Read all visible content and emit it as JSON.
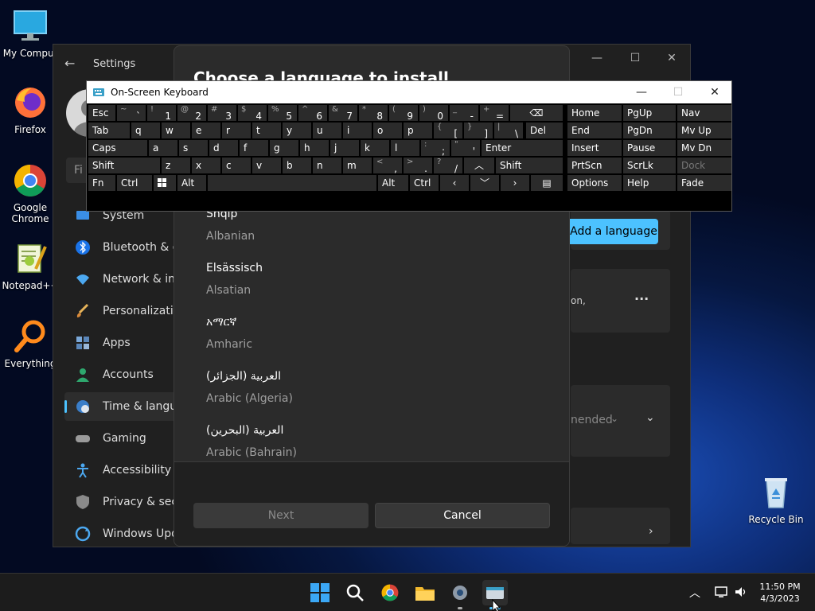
{
  "desktop": {
    "icons": [
      {
        "label": "My Comput"
      },
      {
        "label": "Firefox"
      },
      {
        "label": "Google Chrome"
      },
      {
        "label": "Notepad++"
      },
      {
        "label": "Everything"
      },
      {
        "label": "Recycle Bin"
      }
    ]
  },
  "settings": {
    "title": "Settings",
    "search_placeholder": "Fi",
    "nav": [
      {
        "label": "System"
      },
      {
        "label": "Bluetooth & de"
      },
      {
        "label": "Network & inte"
      },
      {
        "label": "Personalization"
      },
      {
        "label": "Apps"
      },
      {
        "label": "Accounts"
      },
      {
        "label": "Time & langua"
      },
      {
        "label": "Gaming"
      },
      {
        "label": "Accessibility"
      },
      {
        "label": "Privacy & secu"
      },
      {
        "label": "Windows Upda"
      }
    ],
    "add_language_label": "Add a language",
    "card_text": "on,",
    "more_label": "···",
    "recommended_text": "nended"
  },
  "dialog": {
    "title": "Choose a language to install",
    "languages": [
      {
        "native": "Shqip",
        "english": "Albanian"
      },
      {
        "native": "Elsässisch",
        "english": "Alsatian"
      },
      {
        "native": "አማርኛ",
        "english": "Amharic"
      },
      {
        "native": "العربية (الجزائر)",
        "english": "Arabic (Algeria)"
      },
      {
        "native": "العربية (البحرين)",
        "english": "Arabic (Bahrain)"
      }
    ],
    "next_label": "Next",
    "cancel_label": "Cancel"
  },
  "osk": {
    "title": "On-Screen Keyboard",
    "rows": {
      "r1": {
        "esc": "Esc",
        "keys": [
          {
            "sh": "~",
            "mn": "`"
          },
          {
            "sh": "!",
            "mn": "1"
          },
          {
            "sh": "@",
            "mn": "2"
          },
          {
            "sh": "#",
            "mn": "3"
          },
          {
            "sh": "$",
            "mn": "4"
          },
          {
            "sh": "%",
            "mn": "5"
          },
          {
            "sh": "^",
            "mn": "6"
          },
          {
            "sh": "&",
            "mn": "7"
          },
          {
            "sh": "*",
            "mn": "8"
          },
          {
            "sh": "(",
            "mn": "9"
          },
          {
            "sh": ")",
            "mn": "0"
          },
          {
            "sh": "_",
            "mn": "-"
          },
          {
            "sh": "+",
            "mn": "="
          }
        ]
      },
      "r2": {
        "tab": "Tab",
        "keys": [
          "q",
          "w",
          "e",
          "r",
          "t",
          "y",
          "u",
          "i",
          "o",
          "p"
        ],
        "brackets": [
          {
            "sh": "{",
            "mn": "["
          },
          {
            "sh": "}",
            "mn": "]"
          },
          {
            "sh": "|",
            "mn": "\\"
          }
        ],
        "del": "Del"
      },
      "r3": {
        "caps": "Caps",
        "keys": [
          "a",
          "s",
          "d",
          "f",
          "g",
          "h",
          "j",
          "k",
          "l"
        ],
        "punct": [
          {
            "sh": ":",
            "mn": ";"
          },
          {
            "sh": "\"",
            "mn": "'"
          }
        ],
        "enter": "Enter"
      },
      "r4": {
        "shift": "Shift",
        "keys": [
          "z",
          "x",
          "c",
          "v",
          "b",
          "n",
          "m"
        ],
        "punct": [
          {
            "sh": "<",
            "mn": ","
          },
          {
            "sh": ">",
            "mn": "."
          },
          {
            "sh": "?",
            "mn": "/"
          }
        ],
        "shift_r": "Shift"
      },
      "r5": {
        "fn": "Fn",
        "ctrl": "Ctrl",
        "alt": "Alt",
        "alt_r": "Alt",
        "ctrl_r": "Ctrl"
      }
    },
    "nav_keys": [
      [
        "Home",
        "PgUp",
        "Nav"
      ],
      [
        "End",
        "PgDn",
        "Mv Up"
      ],
      [
        "Insert",
        "Pause",
        "Mv Dn"
      ],
      [
        "PrtScn",
        "ScrLk",
        "Dock"
      ],
      [
        "Options",
        "Help",
        "Fade"
      ]
    ]
  },
  "taskbar": {
    "time": "11:50 PM",
    "date": "4/3/2023"
  },
  "colors": {
    "accent": "#4cc2ff",
    "settings_bg": "#202020",
    "dialog_bg": "#2b2b2b"
  }
}
